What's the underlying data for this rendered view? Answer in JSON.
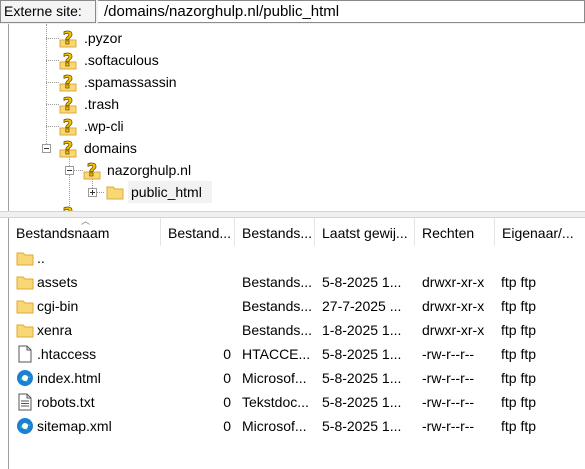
{
  "sitebar": {
    "label": "Externe site:",
    "path": "/domains/nazorghulp.nl/public_html"
  },
  "tree": {
    "items": [
      {
        "label": ".pyzor",
        "icon": "unknown-folder-icon"
      },
      {
        "label": ".softaculous",
        "icon": "unknown-folder-icon"
      },
      {
        "label": ".spamassassin",
        "icon": "unknown-folder-icon"
      },
      {
        "label": ".trash",
        "icon": "unknown-folder-icon"
      },
      {
        "label": ".wp-cli",
        "icon": "unknown-folder-icon"
      },
      {
        "label": "domains",
        "icon": "unknown-folder-icon",
        "expanded": true
      },
      {
        "label": "nazorghulp.nl",
        "icon": "unknown-folder-icon",
        "expanded": true
      },
      {
        "label": "public_html",
        "icon": "folder-icon",
        "selected": true
      }
    ]
  },
  "list": {
    "columns": [
      "Bestandsnaam",
      "Bestand...",
      "Bestands...",
      "Laatst gewij...",
      "Rechten",
      "Eigenaar/..."
    ],
    "rows": [
      {
        "name": "..",
        "size": "",
        "type": "",
        "modified": "",
        "perms": "",
        "owner": "",
        "icon": "folder-icon"
      },
      {
        "name": "assets",
        "size": "",
        "type": "Bestands...",
        "modified": "5-8-2025 1...",
        "perms": "drwxr-xr-x",
        "owner": "ftp ftp",
        "icon": "folder-icon"
      },
      {
        "name": "cgi-bin",
        "size": "",
        "type": "Bestands...",
        "modified": "27-7-2025 ...",
        "perms": "drwxr-xr-x",
        "owner": "ftp ftp",
        "icon": "folder-icon"
      },
      {
        "name": "xenra",
        "size": "",
        "type": "Bestands...",
        "modified": "1-8-2025 1...",
        "perms": "drwxr-xr-x",
        "owner": "ftp ftp",
        "icon": "folder-icon"
      },
      {
        "name": ".htaccess",
        "size": "0",
        "type": "HTACCE...",
        "modified": "5-8-2025 1...",
        "perms": "-rw-r--r--",
        "owner": "ftp ftp",
        "icon": "blank-file-icon"
      },
      {
        "name": "index.html",
        "size": "0",
        "type": "Microsof...",
        "modified": "5-8-2025 1...",
        "perms": "-rw-r--r--",
        "owner": "ftp ftp",
        "icon": "edge-icon"
      },
      {
        "name": "robots.txt",
        "size": "0",
        "type": "Tekstdoc...",
        "modified": "5-8-2025 1...",
        "perms": "-rw-r--r--",
        "owner": "ftp ftp",
        "icon": "text-file-icon"
      },
      {
        "name": "sitemap.xml",
        "size": "0",
        "type": "Microsof...",
        "modified": "5-8-2025 1...",
        "perms": "-rw-r--r--",
        "owner": "ftp ftp",
        "icon": "edge-icon"
      }
    ]
  },
  "colors": {
    "folder": "#f8d775",
    "folder_dark": "#e0a93a",
    "question": "#f5c400",
    "edge_blue": "#1b7fd6",
    "edge_green": "#35c26b"
  }
}
